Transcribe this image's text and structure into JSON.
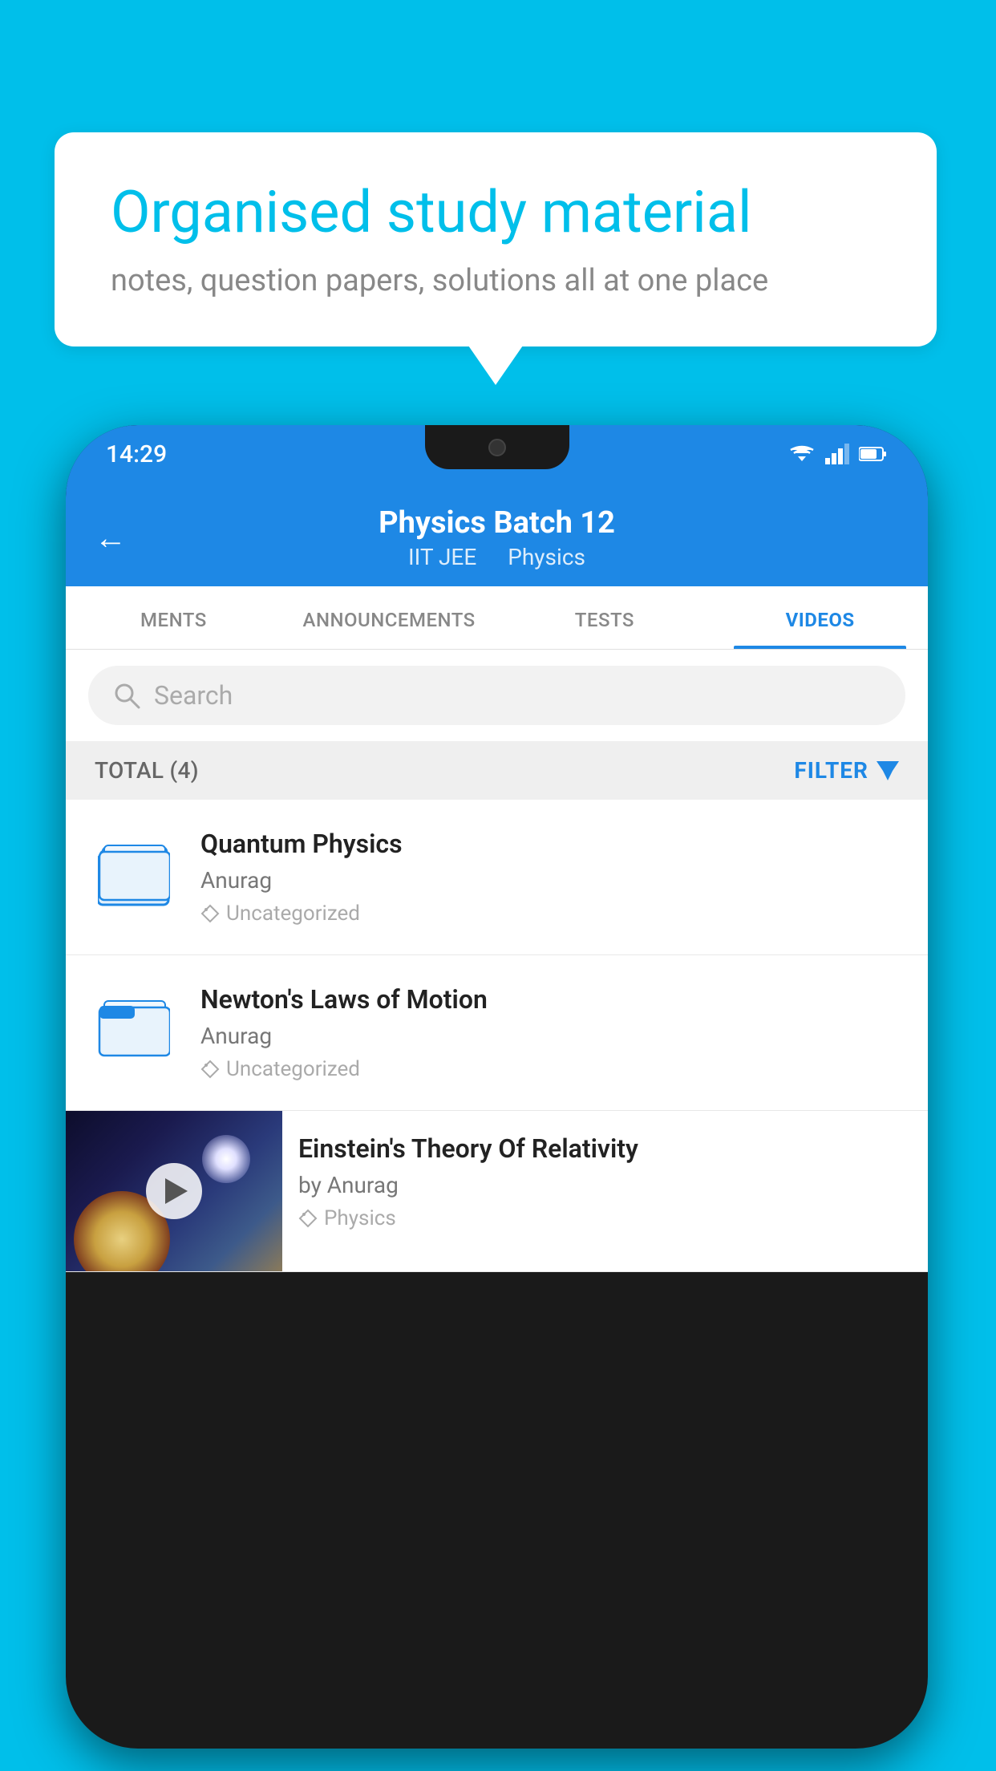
{
  "background": {
    "color": "#00BFEA"
  },
  "bubble": {
    "title": "Organised study material",
    "subtitle": "notes, question papers, solutions all at one place"
  },
  "phone": {
    "status_bar": {
      "time": "14:29"
    },
    "header": {
      "title": "Physics Batch 12",
      "tag1": "IIT JEE",
      "tag2": "Physics",
      "back_label": "←"
    },
    "tabs": [
      {
        "label": "MENTS",
        "active": false
      },
      {
        "label": "ANNOUNCEMENTS",
        "active": false
      },
      {
        "label": "TESTS",
        "active": false
      },
      {
        "label": "VIDEOS",
        "active": true
      }
    ],
    "search": {
      "placeholder": "Search"
    },
    "filter": {
      "total_label": "TOTAL (4)",
      "filter_label": "FILTER"
    },
    "videos": [
      {
        "title": "Quantum Physics",
        "author": "Anurag",
        "tag": "Uncategorized",
        "type": "folder"
      },
      {
        "title": "Newton's Laws of Motion",
        "author": "Anurag",
        "tag": "Uncategorized",
        "type": "folder"
      },
      {
        "title": "Einstein's Theory Of Relativity",
        "author": "by Anurag",
        "tag": "Physics",
        "type": "video"
      }
    ]
  }
}
